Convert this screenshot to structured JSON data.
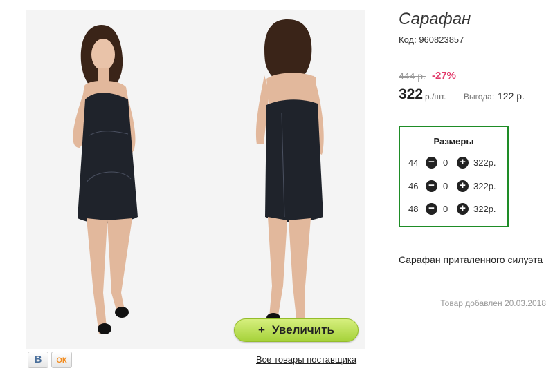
{
  "gallery": {
    "zoom_label": "Увеличить",
    "zoom_plus": "+",
    "supplier_link": "Все товары поставщика",
    "share_vk": "В",
    "share_ok": "ОК",
    "accent_color": "#a6d23a"
  },
  "product": {
    "title": "Сарафан",
    "code": "Код: 960823857",
    "old_price": "444 р.",
    "discount": "-27%",
    "price": "322",
    "unit": "р./шт.",
    "benefit_label": "Выгода:",
    "benefit_value": "122 р.",
    "description": "Сарафан приталенного силуэта",
    "added": "Товар добавлен 20.03.2018"
  },
  "sizes": {
    "title": "Размеры",
    "border_color": "#1e8c26",
    "rows": [
      {
        "size": "44",
        "qty": "0",
        "price": "322р."
      },
      {
        "size": "46",
        "qty": "0",
        "price": "322р."
      },
      {
        "size": "48",
        "qty": "0",
        "price": "322р."
      }
    ]
  }
}
